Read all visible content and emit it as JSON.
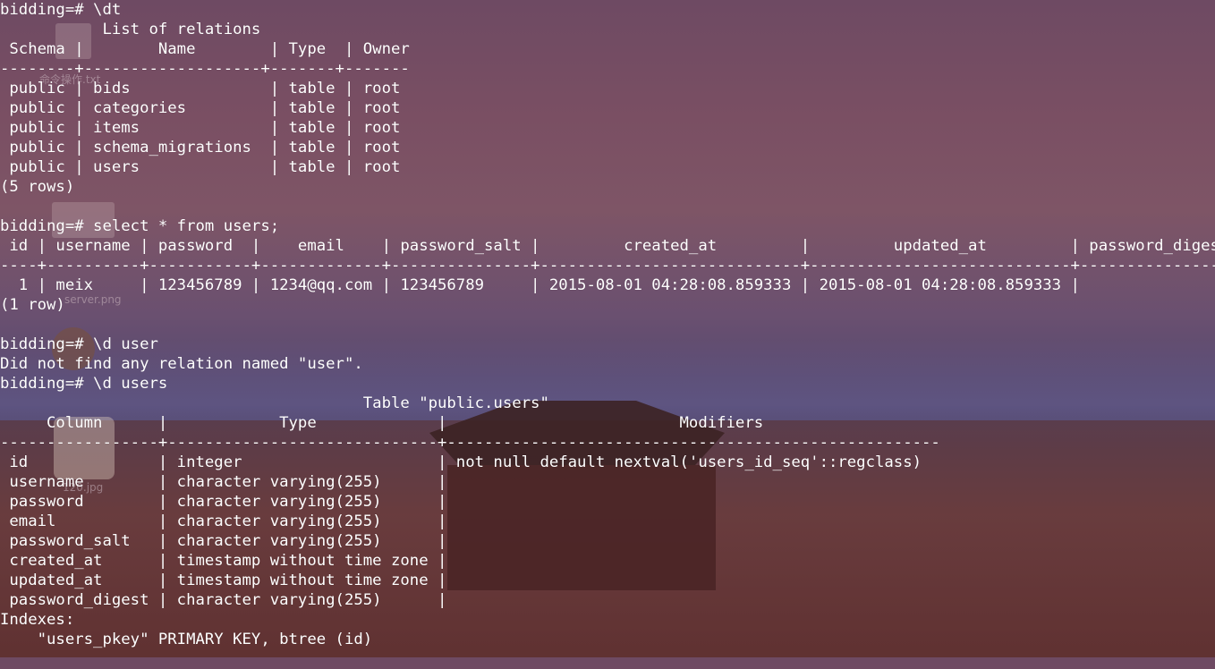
{
  "terminal": {
    "lines": [
      "bidding=# \\dt",
      "           List of relations",
      " Schema |        Name        | Type  | Owner ",
      "--------+-------------------+-------+-------",
      " public | bids               | table | root",
      " public | categories         | table | root",
      " public | items              | table | root",
      " public | schema_migrations  | table | root",
      " public | users              | table | root",
      "(5 rows)",
      "",
      "bidding=# select * from users;",
      " id | username | password  |    email    | password_salt |         created_at         |         updated_at         | password_digest",
      "----+----------+-----------+-------------+---------------+----------------------------+----------------------------+-----------------",
      "  1 | meix     | 123456789 | 1234@qq.com | 123456789     | 2015-08-01 04:28:08.859333 | 2015-08-01 04:28:08.859333 |",
      "(1 row)",
      "",
      "bidding=# \\d user",
      "Did not find any relation named \"user\".",
      "bidding=# \\d users",
      "                                       Table \"public.users\"",
      "     Column      |            Type             |                         Modifiers",
      "-----------------+-----------------------------+-----------------------------------------------------",
      " id              | integer                     | not null default nextval('users_id_seq'::regclass)",
      " username        | character varying(255)      |",
      " password        | character varying(255)      |",
      " email           | character varying(255)      |",
      " password_salt   | character varying(255)      |",
      " created_at      | timestamp without time zone |",
      " updated_at      | timestamp without time zone |",
      " password_digest | character varying(255)      |",
      "Indexes:",
      "    \"users_pkey\" PRIMARY KEY, btree (id)"
    ]
  },
  "desktop": {
    "labels": [
      "命令操作.txt",
      "server.png",
      "120.jpg"
    ]
  }
}
